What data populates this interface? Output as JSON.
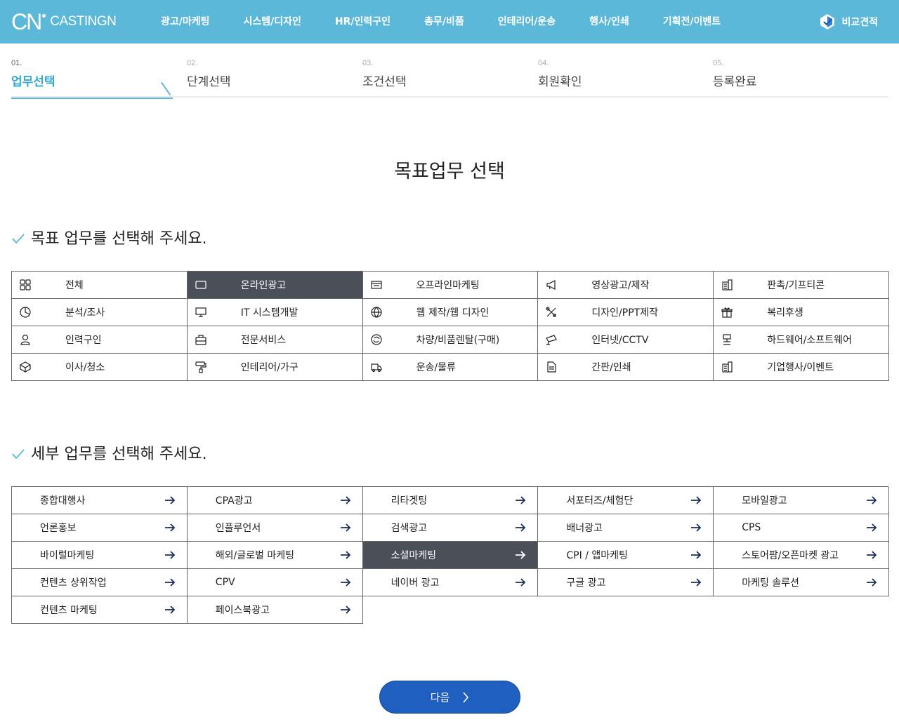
{
  "header": {
    "logo_mark": "CN",
    "logo_text": "CASTINGN",
    "nav": [
      "광고/마케팅",
      "시스템/디자인",
      "HR/인력구인",
      "총무/비품",
      "인테리어/운송",
      "행사/인쇄",
      "기획전/이벤트"
    ],
    "compare_label": "비교견적"
  },
  "steps": [
    {
      "num": "01.",
      "label": "업무선택",
      "active": true
    },
    {
      "num": "02.",
      "label": "단계선택",
      "active": false
    },
    {
      "num": "03.",
      "label": "조건선택",
      "active": false
    },
    {
      "num": "04.",
      "label": "회원확인",
      "active": false
    },
    {
      "num": "05.",
      "label": "등록완료",
      "active": false
    }
  ],
  "main_title": "목표업무 선택",
  "section1": {
    "title": "목표 업무를 선택해 주세요.",
    "items": [
      {
        "label": "전체",
        "icon": "grid-icon",
        "selected": false
      },
      {
        "label": "온라인광고",
        "icon": "ad-icon",
        "selected": true
      },
      {
        "label": "오프라인마케팅",
        "icon": "store-icon",
        "selected": false
      },
      {
        "label": "영상광고/제작",
        "icon": "megaphone-icon",
        "selected": false
      },
      {
        "label": "판촉/기프티콘",
        "icon": "building-icon",
        "selected": false
      },
      {
        "label": "분석/조사",
        "icon": "pie-chart-icon",
        "selected": false
      },
      {
        "label": "IT 시스템개발",
        "icon": "monitor-icon",
        "selected": false
      },
      {
        "label": "웹 제작/웹 디자인",
        "icon": "globe-icon",
        "selected": false
      },
      {
        "label": "디자인/PPT제작",
        "icon": "tools-icon",
        "selected": false
      },
      {
        "label": "복리후생",
        "icon": "gift-icon",
        "selected": false
      },
      {
        "label": "인력구인",
        "icon": "person-icon",
        "selected": false
      },
      {
        "label": "전문서비스",
        "icon": "briefcase-icon",
        "selected": false
      },
      {
        "label": "차량/비품렌탈(구매)",
        "icon": "refresh-icon",
        "selected": false
      },
      {
        "label": "인터넷/CCTV",
        "icon": "cctv-icon",
        "selected": false
      },
      {
        "label": "하드웨어/소프트웨어",
        "icon": "hardware-icon",
        "selected": false
      },
      {
        "label": "이사/청소",
        "icon": "box-icon",
        "selected": false
      },
      {
        "label": "인테리어/가구",
        "icon": "paint-roller-icon",
        "selected": false
      },
      {
        "label": "운송/물류",
        "icon": "truck-icon",
        "selected": false
      },
      {
        "label": "간판/인쇄",
        "icon": "document-icon",
        "selected": false
      },
      {
        "label": "기업행사/이벤트",
        "icon": "building-icon",
        "selected": false
      }
    ]
  },
  "section2": {
    "title": "세부 업무를 선택해 주세요.",
    "items": [
      {
        "label": "종합대행사",
        "selected": false
      },
      {
        "label": "CPA광고",
        "selected": false
      },
      {
        "label": "리타겟팅",
        "selected": false
      },
      {
        "label": "서포터즈/체험단",
        "selected": false
      },
      {
        "label": "모바일광고",
        "selected": false
      },
      {
        "label": "언론홍보",
        "selected": false
      },
      {
        "label": "인플루언서",
        "selected": false
      },
      {
        "label": "검색광고",
        "selected": false
      },
      {
        "label": "배너광고",
        "selected": false
      },
      {
        "label": "CPS",
        "selected": false
      },
      {
        "label": "바이럴마케팅",
        "selected": false
      },
      {
        "label": "해외/글로벌 마케팅",
        "selected": false
      },
      {
        "label": "소셜마케팅",
        "selected": true
      },
      {
        "label": "CPI / 앱마케팅",
        "selected": false
      },
      {
        "label": "스토어팜/오픈마켓 광고",
        "selected": false
      },
      {
        "label": "컨텐츠 상위작업",
        "selected": false
      },
      {
        "label": "CPV",
        "selected": false
      },
      {
        "label": "네이버 광고",
        "selected": false
      },
      {
        "label": "구글 광고",
        "selected": false
      },
      {
        "label": "마케팅 솔루션",
        "selected": false
      },
      {
        "label": "컨텐츠 마케팅",
        "selected": false
      },
      {
        "label": "페이스북광고",
        "selected": false
      }
    ]
  },
  "next_button": "다음",
  "colors": {
    "header": "#5cb8d9",
    "selected": "#4a4f58",
    "button": "#1f5fbf",
    "active_step": "#34a9d5"
  }
}
